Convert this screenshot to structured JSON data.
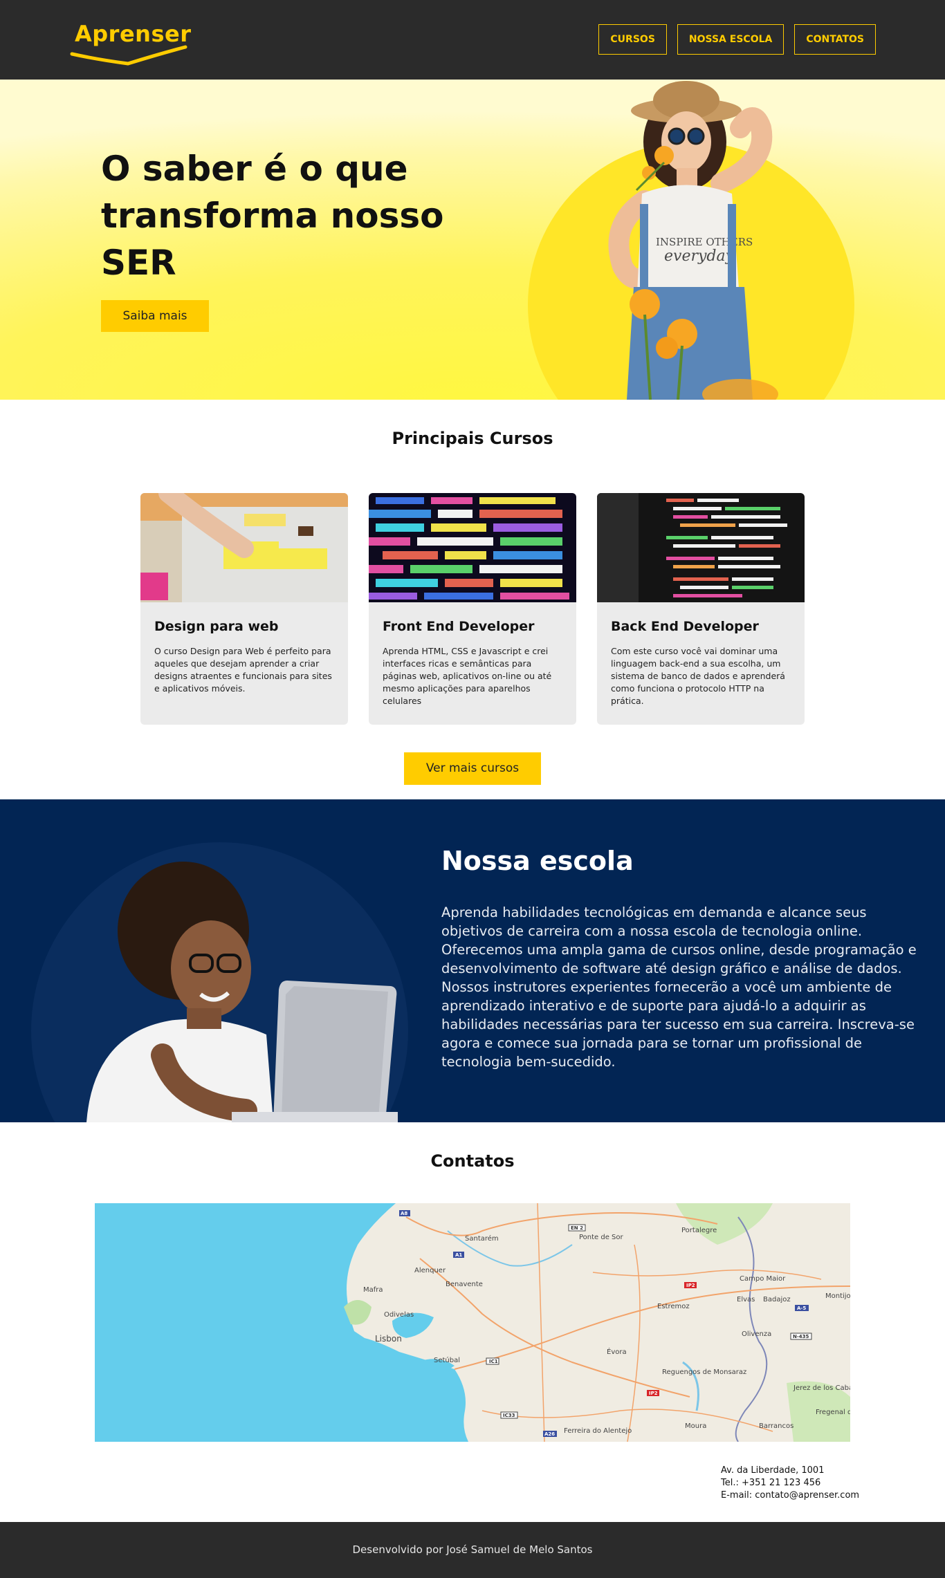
{
  "header": {
    "logo": "Aprenser",
    "nav": [
      "CURSOS",
      "NOSSA ESCOLA",
      "CONTATOS"
    ]
  },
  "hero": {
    "title": "O saber é o que transforma nosso SER",
    "button": "Saiba mais"
  },
  "courses": {
    "title": "Principais Cursos",
    "items": [
      {
        "title": "Design para web",
        "description": "O curso Design para Web é perfeito para aqueles que desejam aprender a criar designs atraentes e funcionais para sites e aplicativos móveis."
      },
      {
        "title": "Front End Developer",
        "description": "Aprenda HTML, CSS e Javascript e crei interfaces ricas e semânticas para páginas web, aplicativos on-line ou até mesmo aplicações para aparelhos celulares"
      },
      {
        "title": "Back End Developer",
        "description": "Com este curso você vai dominar uma linguagem back-end a sua escolha, um sistema de banco de dados e aprenderá como funciona o protocolo HTTP na prática."
      }
    ],
    "more_button": "Ver mais cursos"
  },
  "school": {
    "title": "Nossa escola",
    "text": "Aprenda habilidades tecnológicas em demanda e alcance seus objetivos de carreira com a nossa escola de tecnologia online. Oferecemos uma ampla gama de cursos online, desde programação e desenvolvimento de software até design gráfico e análise de dados. Nossos instrutores experientes fornecerão a você um ambiente de aprendizado interativo e de suporte para ajudá-lo a adquirir as habilidades necessárias para ter sucesso em sua carreira. Inscreva-se agora e comece sua jornada para se tornar um profissional de tecnologia bem-sucedido."
  },
  "contacts": {
    "title": "Contatos",
    "map_labels": [
      "Santarém",
      "Ponte de Sor",
      "Portalegre",
      "Alenquer",
      "Benavente",
      "Campo Maior",
      "Mafra",
      "Estremoz",
      "Elvas",
      "Badajoz",
      "Montijo",
      "Odivelas",
      "Lisbon",
      "Olivenza",
      "Setúbal",
      "Évora",
      "Reguengos de Monsaraz",
      "Jerez de los Caballeros",
      "Fregenal de la Sierra",
      "Moura",
      "Barrancos",
      "Ferreira do Alentejo"
    ],
    "map_road_labels": [
      "A8",
      "EN 2",
      "A1",
      "IP2",
      "A-5",
      "N-435",
      "IC1",
      "IP2",
      "IC33",
      "A26"
    ],
    "address": [
      "Av. da Liberdade, 1001",
      "Tel.: +351 21 123 456",
      "E-mail: contato@aprenser.com"
    ]
  },
  "footer": {
    "text": "Desenvolvido por José Samuel de Melo Santos"
  },
  "colors": {
    "accent": "#ffcc00",
    "dark": "#2b2b2b",
    "navy": "#022554"
  }
}
